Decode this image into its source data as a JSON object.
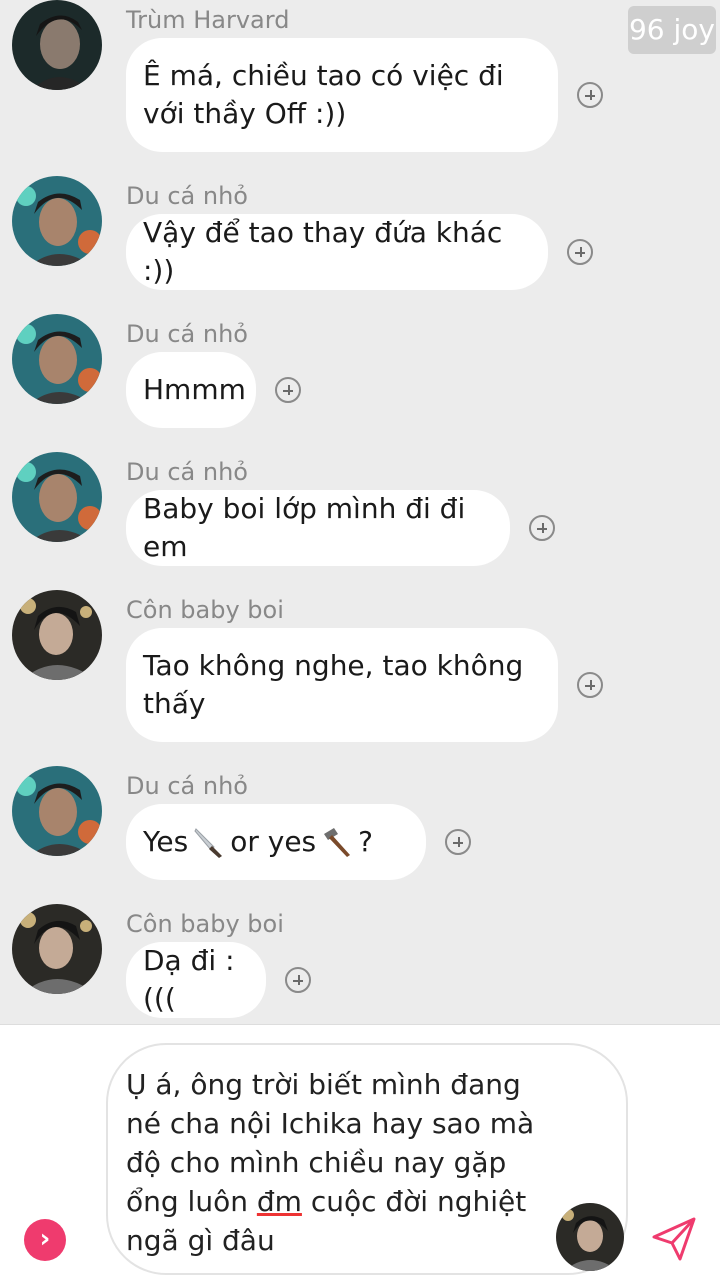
{
  "watermark": "96 joy",
  "messages": [
    {
      "sender": "Trùm Harvard",
      "text": "Ê má, chiều tao có việc đi với thầy Off :))"
    },
    {
      "sender": "Du cá nhỏ",
      "text": "Vậy để tao thay đứa khác :))"
    },
    {
      "sender": "Du cá nhỏ",
      "text": "Hmmm"
    },
    {
      "sender": "Du cá nhỏ",
      "text": "Baby boi lớp mình đi đi em"
    },
    {
      "sender": "Côn baby boi",
      "text": "Tao không nghe, tao không thấy"
    },
    {
      "sender": "Du cá nhỏ",
      "text_a": "Yes",
      "text_b": "or yes",
      "text_c": "?",
      "emoji_1": "knife-emoji",
      "emoji_2": "hammer-emoji"
    },
    {
      "sender": "Côn baby boi",
      "text": "Dạ đi :((("
    }
  ],
  "composer": {
    "text_before": "Ụ á, ông trời biết mình đang né cha nội Ichika hay sao mà độ cho mình chiều nay gặp ổng luôn ",
    "text_underlined": "đm",
    "text_after": " cuộc đời nghiệt ngã gì đâu",
    "expand_icon": "chevron-right-icon",
    "send_icon": "send-icon"
  },
  "colors": {
    "accent": "#ef3b6e",
    "background": "#ececec",
    "bubble": "#ffffff"
  }
}
